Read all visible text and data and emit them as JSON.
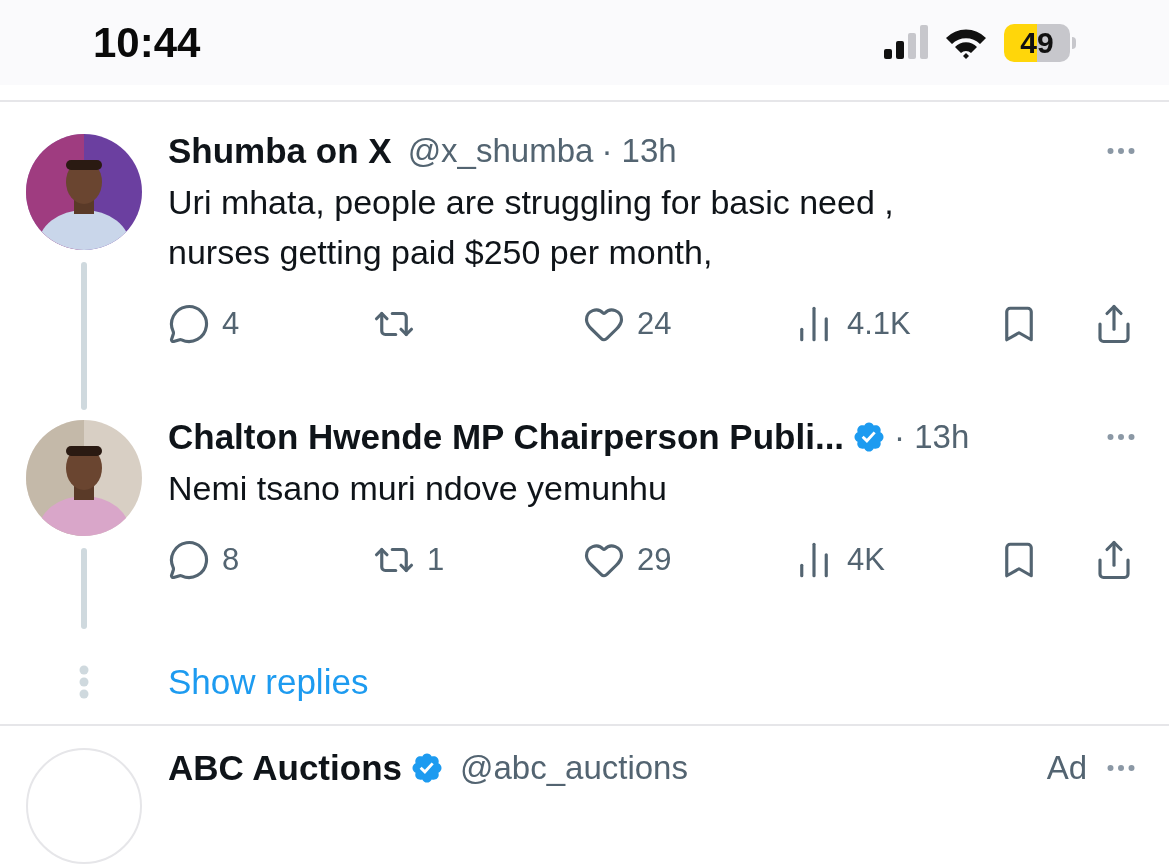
{
  "status_bar": {
    "time": "10:44",
    "battery": "49"
  },
  "posts": [
    {
      "name": "Shumba on X",
      "handle": "@x_shumba",
      "time": "· 13h",
      "text": "Uri mhata, people are struggling for basic need ,\nnurses getting paid $250 per month,",
      "stats": {
        "replies": "4",
        "likes": "24",
        "views": "4.1K"
      }
    },
    {
      "name": "Chalton Hwende MP Chairperson Publi...",
      "verified": true,
      "time": "· 13h",
      "text": "Nemi tsano muri ndove yemunhu",
      "stats": {
        "replies": "8",
        "reposts": "1",
        "likes": "29",
        "views": "4K"
      }
    }
  ],
  "show_replies": "Show replies",
  "next_post": {
    "name": "ABC Auctions",
    "verified": true,
    "handle": "@abc_auctions",
    "label": "Ad"
  }
}
